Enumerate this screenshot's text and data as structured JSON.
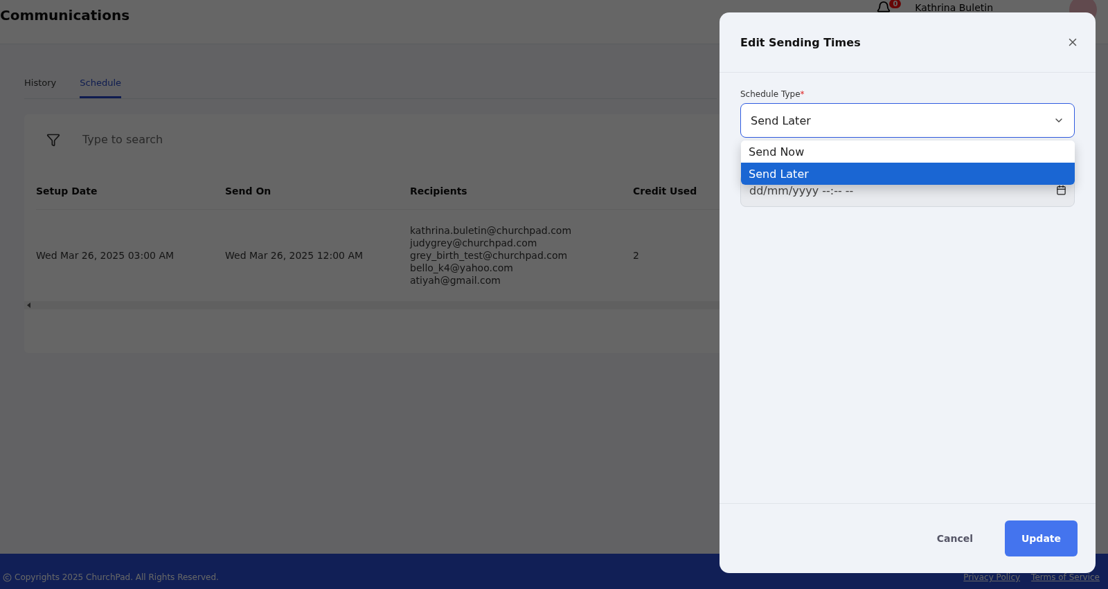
{
  "header": {
    "title": "Communications",
    "notification_count": "0",
    "user_name": "Kathrina Buletin"
  },
  "tabs": [
    {
      "label": "History",
      "selected": false
    },
    {
      "label": "Schedule",
      "selected": true
    }
  ],
  "search": {
    "placeholder": "Type to search"
  },
  "table": {
    "columns": [
      "Setup Date",
      "Send On",
      "Recipients",
      "Credit Used"
    ],
    "rows": [
      {
        "setup_date": "Wed Mar 26, 2025 03:00 AM",
        "send_on": "Wed Mar 26, 2025 12:00 AM",
        "recipients": [
          "kathrina.buletin@churchpad.com",
          "judygrey@churchpad.com",
          "grey_birth_test@churchpad.com",
          "bello_k4@yahoo.com",
          "atiyah@gmail.com"
        ],
        "credit_used": "2"
      }
    ]
  },
  "footer": {
    "copyright": "Copyrights 2025 ChurchPad. All Rights Reserved.",
    "links": [
      "Privacy Policy",
      "Terms of Service"
    ]
  },
  "modal": {
    "title": "Edit Sending Times",
    "schedule_type": {
      "label": "Schedule Type",
      "required_mark": "*",
      "value": "Send Later",
      "expanded": true,
      "options": [
        {
          "label": "Send Now",
          "selected": false
        },
        {
          "label": "Send Later",
          "selected": true
        }
      ]
    },
    "datetime": {
      "placeholder": "dd/mm/yyyy --:-- --"
    },
    "buttons": [
      {
        "label": "Cancel",
        "kind": "secondary"
      },
      {
        "label": "Update",
        "kind": "primary"
      }
    ]
  }
}
